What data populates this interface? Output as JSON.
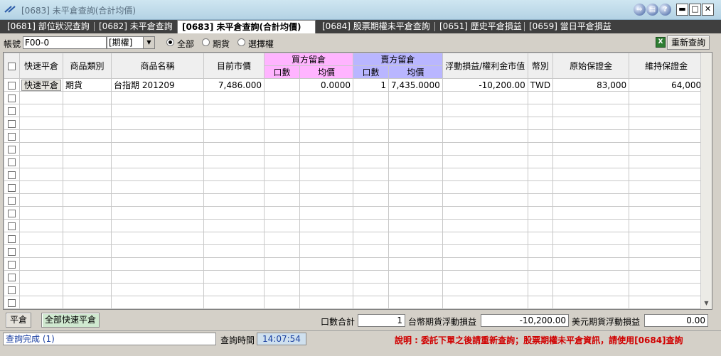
{
  "window": {
    "title": "[0683] 未平倉查詢(合計均價)",
    "buttons": {
      "help": "?",
      "minimize": "▬",
      "maximize": "□",
      "close": "✕"
    }
  },
  "tabs": [
    {
      "label": "[0681] 部位狀況查詢",
      "active": false
    },
    {
      "label": "[0682] 未平倉查詢",
      "active": false
    },
    {
      "label": "[0683] 未平倉查詢(合計均價)",
      "active": true
    },
    {
      "label": "[0684] 股票期權未平倉查詢",
      "active": false
    },
    {
      "label": "[0651] 歷史平倉損益",
      "active": false
    },
    {
      "label": "[0659] 當日平倉損益",
      "active": false
    }
  ],
  "filter": {
    "account_label": "帳號",
    "account_value": "F00-0",
    "type_select": "[期權]",
    "radio_all": "全部",
    "radio_futures": "期貨",
    "radio_options": "選擇權",
    "selected_radio": "all",
    "excel_icon": "excel-icon",
    "requery_button": "重新查詢"
  },
  "grid": {
    "headers": {
      "quick_close": "快速平倉",
      "product_type": "商品類別",
      "product_name": "商品名稱",
      "market_price": "目前市價",
      "buy_group": "買方留倉",
      "sell_group": "賣方留倉",
      "lots": "口數",
      "avg_price": "均價",
      "floating_pl": "浮動損益/權利金市值",
      "currency": "幣別",
      "initial_margin": "原始保證金",
      "maintenance_margin": "維持保證金"
    },
    "rows": [
      {
        "quick_close": "快速平倉",
        "product_type": "期貨",
        "product_name": "台指期 201209",
        "market_price": "7,486.000",
        "buy_lots": "",
        "buy_avg": "0.0000",
        "sell_lots": "1",
        "sell_avg": "7,435.0000",
        "floating_pl": "-10,200.00",
        "currency": "TWD",
        "initial_margin": "83,000",
        "maintenance_margin": "64,000"
      }
    ],
    "empty_row_count": 17
  },
  "bottom": {
    "close_button": "平倉",
    "close_all_button": "全部快速平倉",
    "lots_total_label": "口數合計",
    "lots_total_value": "1",
    "twd_pl_label": "台幣期貨浮動損益",
    "twd_pl_value": "-10,200.00",
    "usd_pl_label": "美元期貨浮動損益",
    "usd_pl_value": "0.00"
  },
  "status": {
    "message": "查詢完成 (1)",
    "time_label": "查詢時間",
    "time_value": "14:07:54",
    "note": "說明 : 委託下單之後請重新查詢；股票期權未平倉資訊，請使用[0684]查詢"
  }
}
